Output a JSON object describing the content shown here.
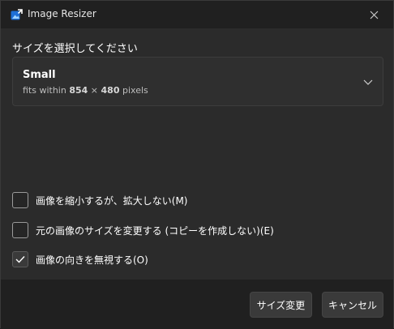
{
  "window": {
    "title": "Image Resizer",
    "app_icon": "image-resizer-app-icon",
    "close_icon": "close-icon"
  },
  "size_section": {
    "label": "サイズを選択してください",
    "selected": {
      "name": "Small",
      "desc_prefix": "fits within ",
      "width": "854",
      "times": " × ",
      "height": "480",
      "unit": " pixels"
    },
    "dropdown_icon": "chevron-down-icon"
  },
  "options": [
    {
      "label": "画像を縮小するが、拡大しない(M)",
      "checked": false
    },
    {
      "label": "元の画像のサイズを変更する (コピーを作成しない)(E)",
      "checked": false
    },
    {
      "label": "画像の向きを無視する(O)",
      "checked": true
    }
  ],
  "footer": {
    "resize_label": "サイズ変更",
    "cancel_label": "キャンセル"
  }
}
